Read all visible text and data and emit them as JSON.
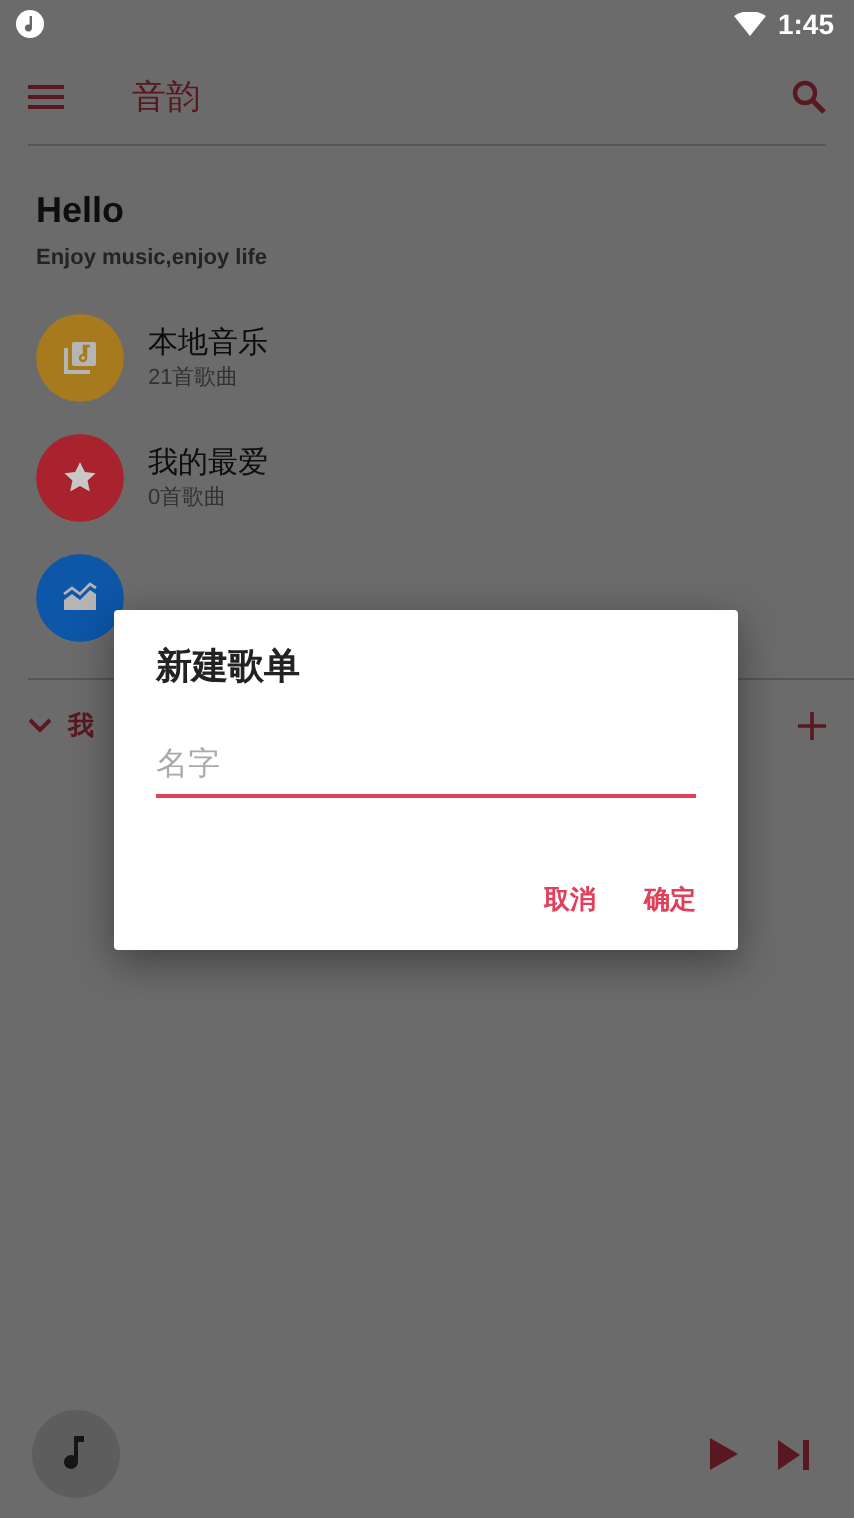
{
  "status_bar": {
    "time": "1:45"
  },
  "app_bar": {
    "title": "音韵"
  },
  "header": {
    "greeting": "Hello",
    "tagline": "Enjoy music,enjoy life"
  },
  "library": [
    {
      "kind": "local",
      "color": "#a77a1e",
      "title": "本地音乐",
      "subtitle": "21首歌曲"
    },
    {
      "kind": "favorite",
      "color": "#a8232d",
      "title": "我的最爱",
      "subtitle": "0首歌曲"
    },
    {
      "kind": "chart",
      "color": "#0d56a8"
    }
  ],
  "section": {
    "label": "我",
    "expanded": true
  },
  "dialog": {
    "title": "新建歌单",
    "placeholder": "名字",
    "buttons": [
      "取消",
      "确定"
    ]
  }
}
